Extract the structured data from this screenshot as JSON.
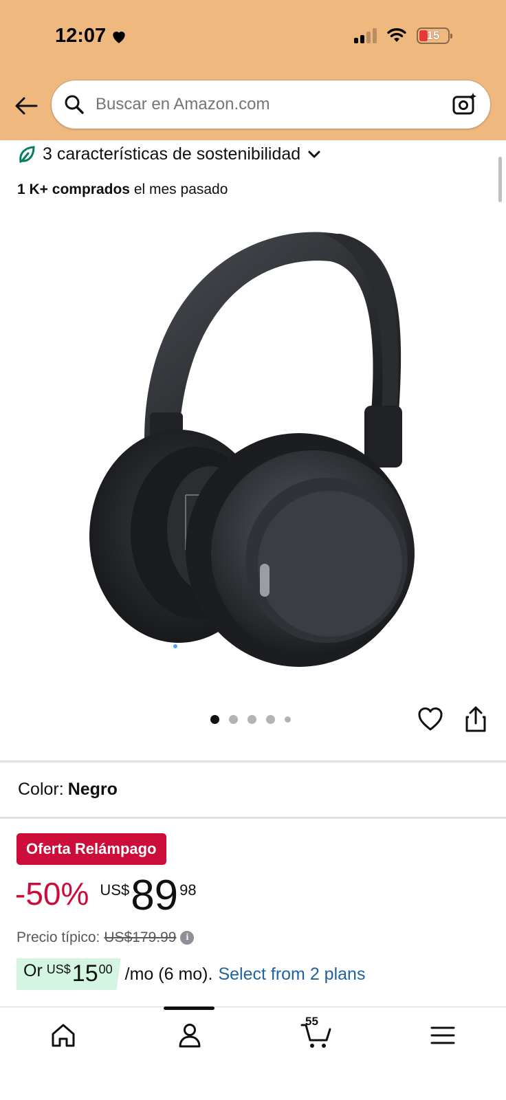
{
  "status_bar": {
    "time": "12:07",
    "battery": "15"
  },
  "search": {
    "placeholder": "Buscar en Amazon.com"
  },
  "sustainability": {
    "label": "3 características de sostenibilidad"
  },
  "purchases": {
    "count": "1 K+ comprados",
    "suffix": "el mes pasado"
  },
  "gallery": {
    "image_count": 5,
    "active_index": 0
  },
  "color": {
    "label": "Color:",
    "value": "Negro"
  },
  "deal": {
    "badge": "Oferta Relámpago"
  },
  "price": {
    "discount": "-50%",
    "currency": "US$",
    "whole": "89",
    "fraction": "98",
    "typical_label": "Precio típico:",
    "typical_value": "US$179.99"
  },
  "installment": {
    "prefix": "Or",
    "currency": "US$",
    "whole": "15",
    "fraction": "00",
    "suffix": "/mo (6 mo).",
    "link": "Select from 2 plans"
  },
  "bottom_nav": {
    "cart_count": "55"
  },
  "colors": {
    "header_bg": "#efb87f",
    "deal_red": "#cc0c39",
    "link_blue": "#2162a1",
    "plan_green": "#d5f5e3"
  }
}
